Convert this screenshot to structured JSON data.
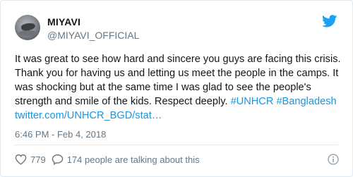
{
  "author": {
    "display_name": "MIYAVI",
    "handle": "@MIYAVI_OFFICIAL"
  },
  "tweet": {
    "text_plain": "It was great to see how hard and sincere you guys are facing this crisis. Thank you for having us and letting us meet the people in the camps. It was shocking but at the same time I was glad to see the people's strength and smile of the kids. Respect deeply. ",
    "hashtag_1": "#UNHCR",
    "hashtag_2": "#Bangladesh",
    "link": "twitter.com/UNHCR_BGD/stat…",
    "timestamp": "6:46 PM - Feb 4, 2018"
  },
  "actions": {
    "like_count": "779",
    "reply_label": "174 people are talking about this"
  },
  "icons": {
    "logo": "twitter-bird-icon",
    "like": "heart-icon",
    "reply": "speech-bubble-icon",
    "info": "info-icon"
  },
  "colors": {
    "brand": "#1da1f2",
    "link": "#1b95e0",
    "text": "#14171a",
    "muted": "#657786",
    "border": "#e1e8ed"
  }
}
